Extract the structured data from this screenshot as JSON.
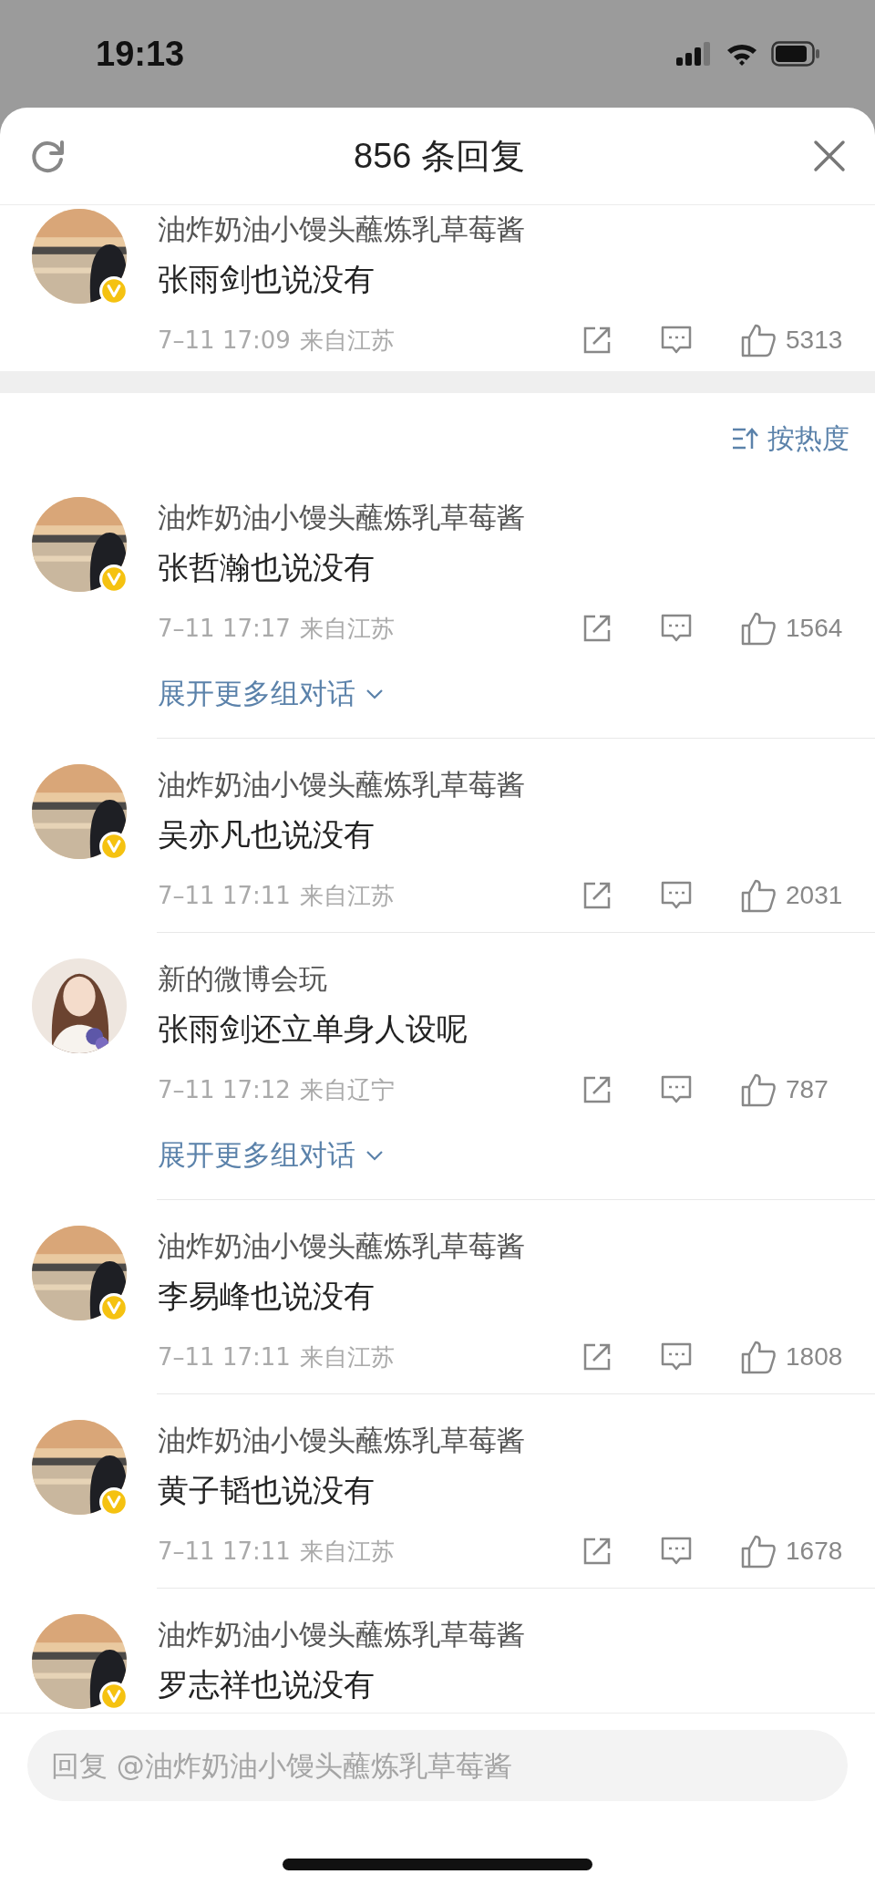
{
  "status_bar": {
    "time": "19:13"
  },
  "header": {
    "title": "856 条回复"
  },
  "root_comment": {
    "user": "油炸奶油小馒头蘸炼乳草莓酱",
    "verified": true,
    "text": "张雨剑也说没有",
    "time": "7–11 17:09",
    "location": "来自江苏",
    "likes": "5313"
  },
  "sort": {
    "label": "按热度"
  },
  "comments": [
    {
      "user": "油炸奶油小馒头蘸炼乳草莓酱",
      "verified": true,
      "text": "张哲瀚也说没有",
      "time": "7–11 17:17",
      "location": "来自江苏",
      "likes": "1564",
      "expand_label": "展开更多组对话"
    },
    {
      "user": "油炸奶油小馒头蘸炼乳草莓酱",
      "verified": true,
      "text": "吴亦凡也说没有",
      "time": "7–11 17:11",
      "location": "来自江苏",
      "likes": "2031"
    },
    {
      "user": "新的微博会玩",
      "verified": false,
      "text": "张雨剑还立单身人设呢",
      "time": "7–11 17:12",
      "location": "来自辽宁",
      "likes": "787",
      "expand_label": "展开更多组对话"
    },
    {
      "user": "油炸奶油小馒头蘸炼乳草莓酱",
      "verified": true,
      "text": "李易峰也说没有",
      "time": "7–11 17:11",
      "location": "来自江苏",
      "likes": "1808"
    },
    {
      "user": "油炸奶油小馒头蘸炼乳草莓酱",
      "verified": true,
      "text": "黄子韬也说没有",
      "time": "7–11 17:11",
      "location": "来自江苏",
      "likes": "1678"
    },
    {
      "user": "油炸奶油小馒头蘸炼乳草莓酱",
      "verified": true,
      "text": "罗志祥也说没有"
    }
  ],
  "reply_field": {
    "placeholder": "回复 @油炸奶油小馒头蘸炼乳草莓酱"
  }
}
